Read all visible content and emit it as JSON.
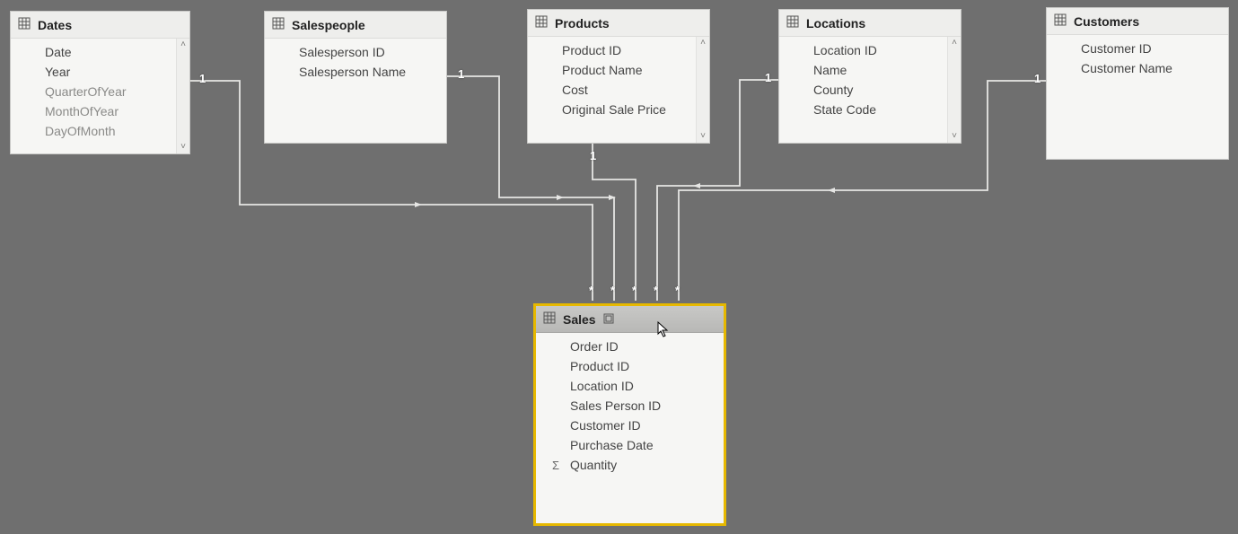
{
  "tables": {
    "dates": {
      "title": "Dates",
      "fields": [
        "Date",
        "Year",
        "QuarterOfYear",
        "MonthOfYear",
        "DayOfMonth"
      ],
      "fadedFrom": 2,
      "hasScrollbar": true,
      "cardinality": "1"
    },
    "salespeople": {
      "title": "Salespeople",
      "fields": [
        "Salesperson ID",
        "Salesperson Name"
      ],
      "fadedFrom": 99,
      "hasScrollbar": false,
      "cardinality": "1"
    },
    "products": {
      "title": "Products",
      "fields": [
        "Product ID",
        "Product Name",
        "Cost",
        "Original Sale Price"
      ],
      "fadedFrom": 99,
      "hasScrollbar": true,
      "cardinality": "1"
    },
    "locations": {
      "title": "Locations",
      "fields": [
        "Location ID",
        "Name",
        "County",
        "State Code"
      ],
      "fadedFrom": 99,
      "hasScrollbar": true,
      "cardinality": "1"
    },
    "customers": {
      "title": "Customers",
      "fields": [
        "Customer ID",
        "Customer Name"
      ],
      "fadedFrom": 99,
      "hasScrollbar": false,
      "cardinality": "1"
    },
    "sales": {
      "title": "Sales",
      "selected": true,
      "fields": [
        "Order ID",
        "Product ID",
        "Location ID",
        "Sales Person ID",
        "Customer ID",
        "Purchase Date",
        "Quantity"
      ],
      "quantityIndex": 6,
      "cardinality": "*"
    }
  },
  "relationships": {
    "oneLabel": "1",
    "manyLabel": "*"
  }
}
